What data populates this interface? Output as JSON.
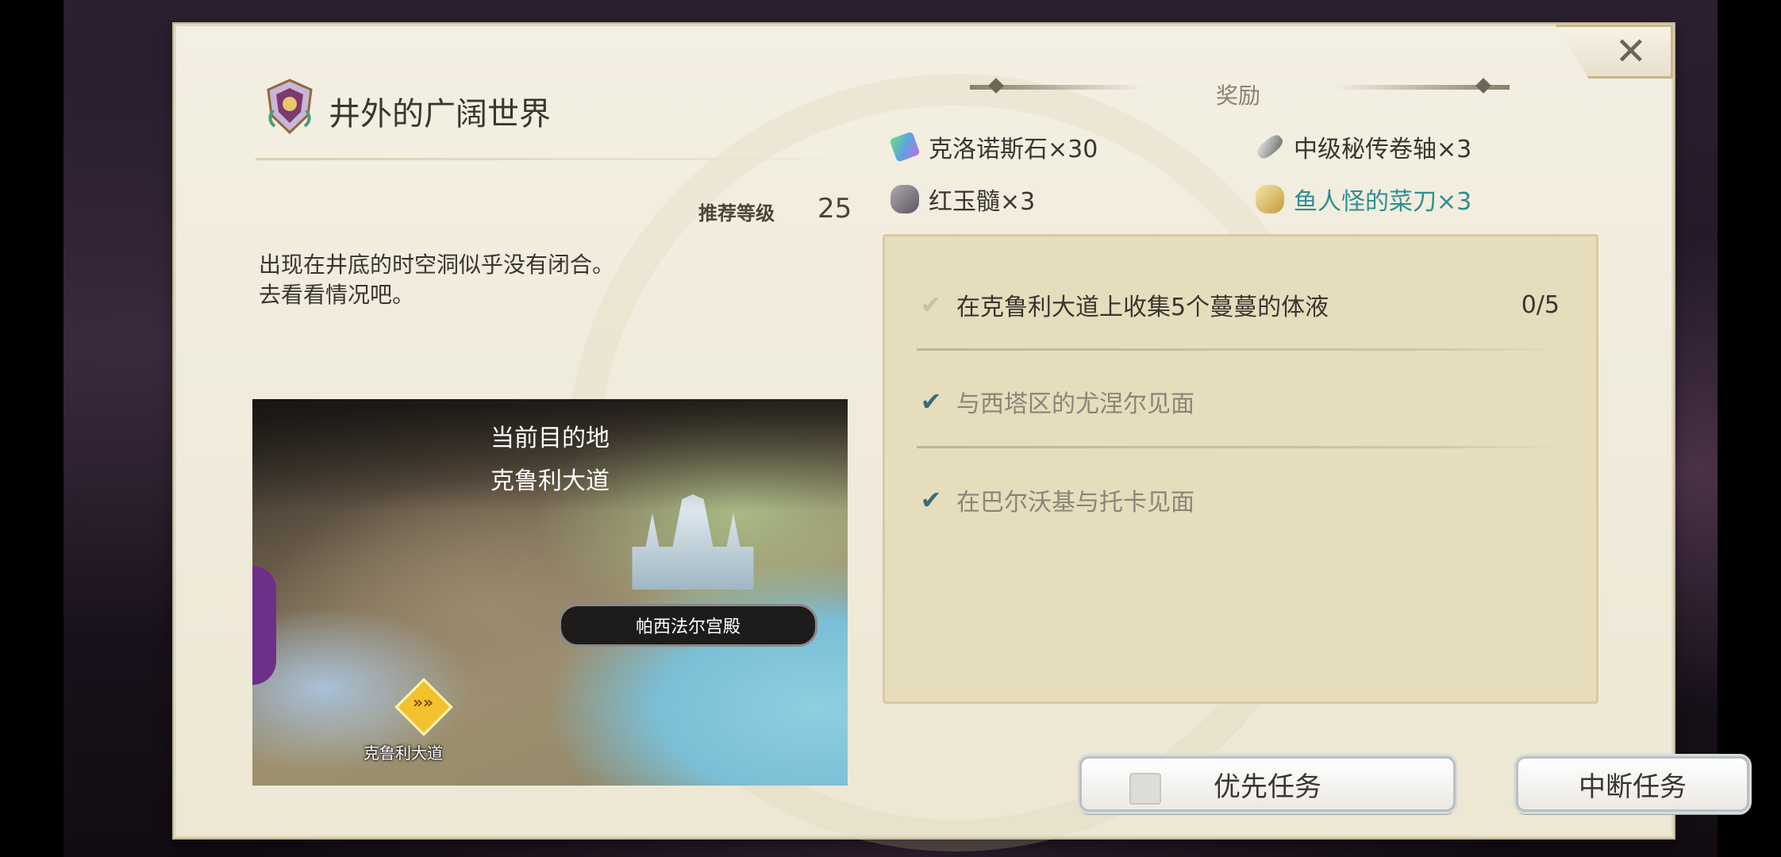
{
  "quest": {
    "title": "井外的广阔世界",
    "level_label": "推荐等级",
    "level_value": "25",
    "description_line1": "出现在井底的时空洞似乎没有闭合。",
    "description_line2": "去看看情况吧。"
  },
  "map": {
    "destination_label": "当前目的地",
    "destination_name": "克鲁利大道",
    "palace_label": "帕西法尔宫殿",
    "marker_label": "克鲁利大道"
  },
  "rewards": {
    "title": "奖励",
    "items": [
      {
        "label": "克洛诺斯石×30",
        "icon": "crystal-icon"
      },
      {
        "label": "中级秘传卷轴×3",
        "icon": "scroll-icon"
      },
      {
        "label": "红玉髓×3",
        "icon": "ore-icon"
      },
      {
        "label": "鱼人怪的菜刀×3",
        "icon": "knife-icon",
        "color": "#2f8f90"
      }
    ]
  },
  "objectives": [
    {
      "text": "在克鲁利大道上收集5个蔓蔓的体液",
      "count": "0/5",
      "done": false
    },
    {
      "text": "与西塔区的尤涅尔见面",
      "done": true
    },
    {
      "text": "在巴尔沃基与托卡见面",
      "done": true
    }
  ],
  "buttons": {
    "priority": "优先任务",
    "abort": "中断任务",
    "close_glyph": "✕"
  },
  "colors": {
    "check_done": "#3a6a7c",
    "check_pending": "#c8c1a8",
    "reward_highlight": "#2f8f90"
  }
}
